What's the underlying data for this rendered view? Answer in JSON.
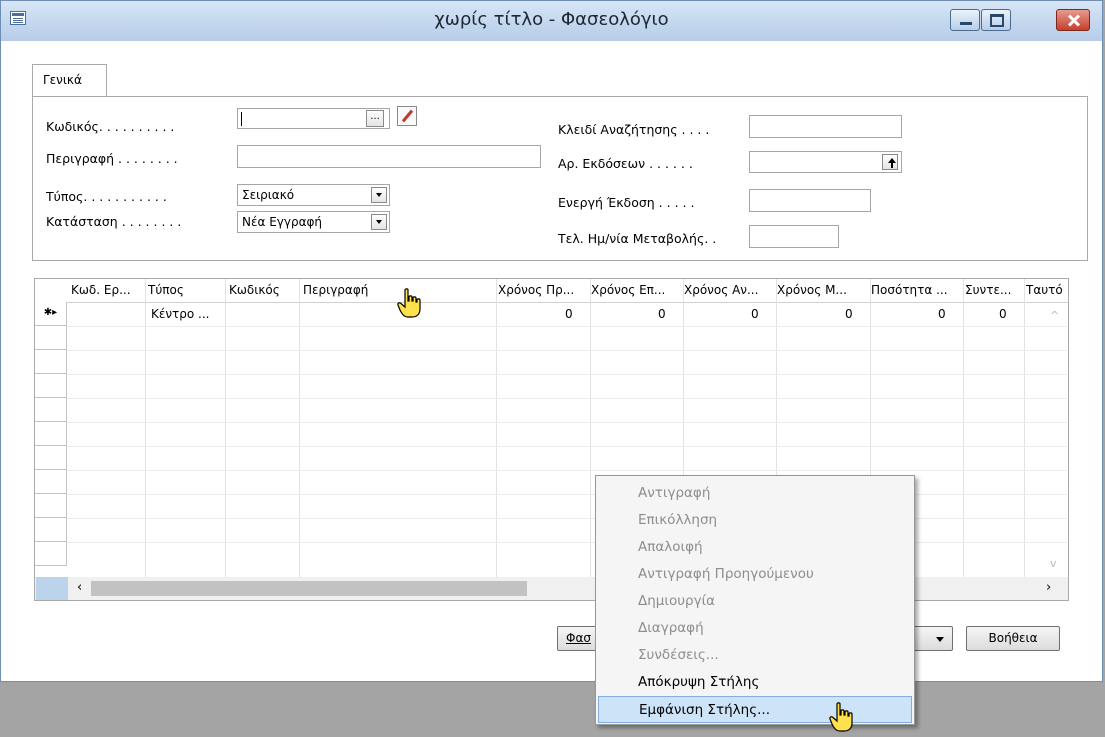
{
  "window": {
    "title": "χωρίς τίτλο - Φασεολόγιο"
  },
  "tabs": [
    "Γενικά"
  ],
  "form": {
    "left": [
      {
        "label": "Κωδικός. . . . . . . . . .",
        "value": ""
      },
      {
        "label": "Περιγραφή . . . . . . . .",
        "value": ""
      },
      {
        "label": "Τύπος. . . . . . . . . . .",
        "value": "Σειριακό"
      },
      {
        "label": "Κατάσταση . . . . . . . .",
        "value": "Νέα Εγγραφή"
      }
    ],
    "right": [
      {
        "label": "Κλειδί Αναζήτησης . . . .",
        "value": ""
      },
      {
        "label": "Αρ. Εκδόσεων . . . . . .",
        "value": ""
      },
      {
        "label": "Ενεργή Έκδοση . . . . .",
        "value": ""
      },
      {
        "label": "Τελ. Ημ/νία Μεταβολής. .",
        "value": ""
      }
    ],
    "ellipsis_button": "..."
  },
  "grid": {
    "columns": [
      "Κωδ. Ερ...",
      "Τύπος",
      "Κωδικός",
      "Περιγραφή",
      "Χρόνος Πρ...",
      "Χρόνος Επ...",
      "Χρόνος Αν...",
      "Χρόνος Μ...",
      "Ποσότητα ...",
      "Συντε...",
      "Ταυτό"
    ],
    "new_row_marker": "✱▸",
    "row": [
      "",
      "Κέντρο ...",
      "",
      "",
      "0",
      "0",
      "0",
      "0",
      "0",
      "0",
      ""
    ]
  },
  "buttons": {
    "partial": "Φασ",
    "help": "Βοήθεια"
  },
  "context_menu": {
    "items": [
      {
        "label": "Αντιγραφή",
        "enabled": false
      },
      {
        "label": "Επικόλληση",
        "enabled": false
      },
      {
        "label": "Απαλοιφή",
        "enabled": false
      },
      {
        "label": "Αντιγραφή Προηγούμενου",
        "enabled": false
      },
      {
        "label": "Δημιουργία",
        "enabled": false
      },
      {
        "label": "Διαγραφή",
        "enabled": false
      },
      {
        "label": "Συνδέσεις...",
        "enabled": false
      },
      {
        "label": "Απόκρυψη Στήλης",
        "enabled": true
      },
      {
        "label": "Εμφάνιση Στήλης...",
        "enabled": true,
        "highlighted": true
      }
    ]
  }
}
